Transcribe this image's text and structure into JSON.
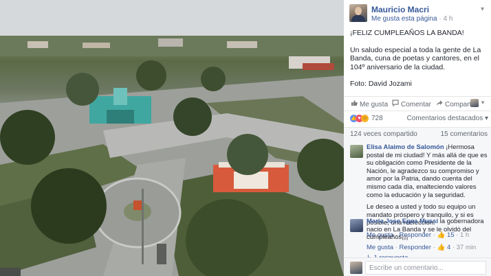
{
  "post": {
    "author": "Mauricio Macri",
    "liked_page": "Me gusta esta página",
    "separator": "·",
    "time": "4 h",
    "options": "▾",
    "title": "¡FELIZ CUMPLEAÑOS LA BANDA!",
    "body": "Un saludo especial a toda la gente de La Banda, cuna de poetas y cantores, en el 104º aniversario de la ciudad.",
    "credit": "Foto: David Jozami"
  },
  "actions": {
    "like": "Me gusta",
    "comment": "Comentar",
    "share": "Compartir"
  },
  "reactions": {
    "count": "728",
    "sort_label": "Comentarios destacados ▾"
  },
  "stats": {
    "shares": "124 veces compartido",
    "comments": "15 comentarios"
  },
  "comments": [
    {
      "name": "Elisa Alaimo de Salomón",
      "text": "¡Hermosa postal de mi ciudad! Y más allá de que es su obligación como Presidente de la Nación, le agradezco su compromiso y amor por la Patria, dando cuenta del mismo cada día, enalteciendo valores como la educación y la seguridad.",
      "text2": "Le deseo a usted y todo su equipo un mandato próspero y tranquilo, y si es posible, una reelección.",
      "like": "Me gusta",
      "reply": "Responder",
      "likes": "15",
      "time": "1 h",
      "avatar_color": "#7a8a6a"
    },
    {
      "name": "Maria Jose Egea Mussi",
      "text": "la gobernadora nacio en La Banda y se le olvidó del cumpleaños¡¡¡",
      "like": "Me gusta",
      "reply": "Responder",
      "likes": "4",
      "time": "37 min",
      "replies": "1 respuesta",
      "avatar_color": "#4a5a7a"
    }
  ],
  "composer": {
    "placeholder": "Escribe un comentario..."
  },
  "icons": {
    "like": "thumbs-up-icon",
    "comment": "speech-bubble-icon",
    "share": "share-arrow-icon"
  },
  "colors": {
    "link": "#365899",
    "muted": "#90949c",
    "like_reaction": "#5890ff",
    "love_reaction": "#f25268",
    "haha_reaction": "#f7b125"
  }
}
